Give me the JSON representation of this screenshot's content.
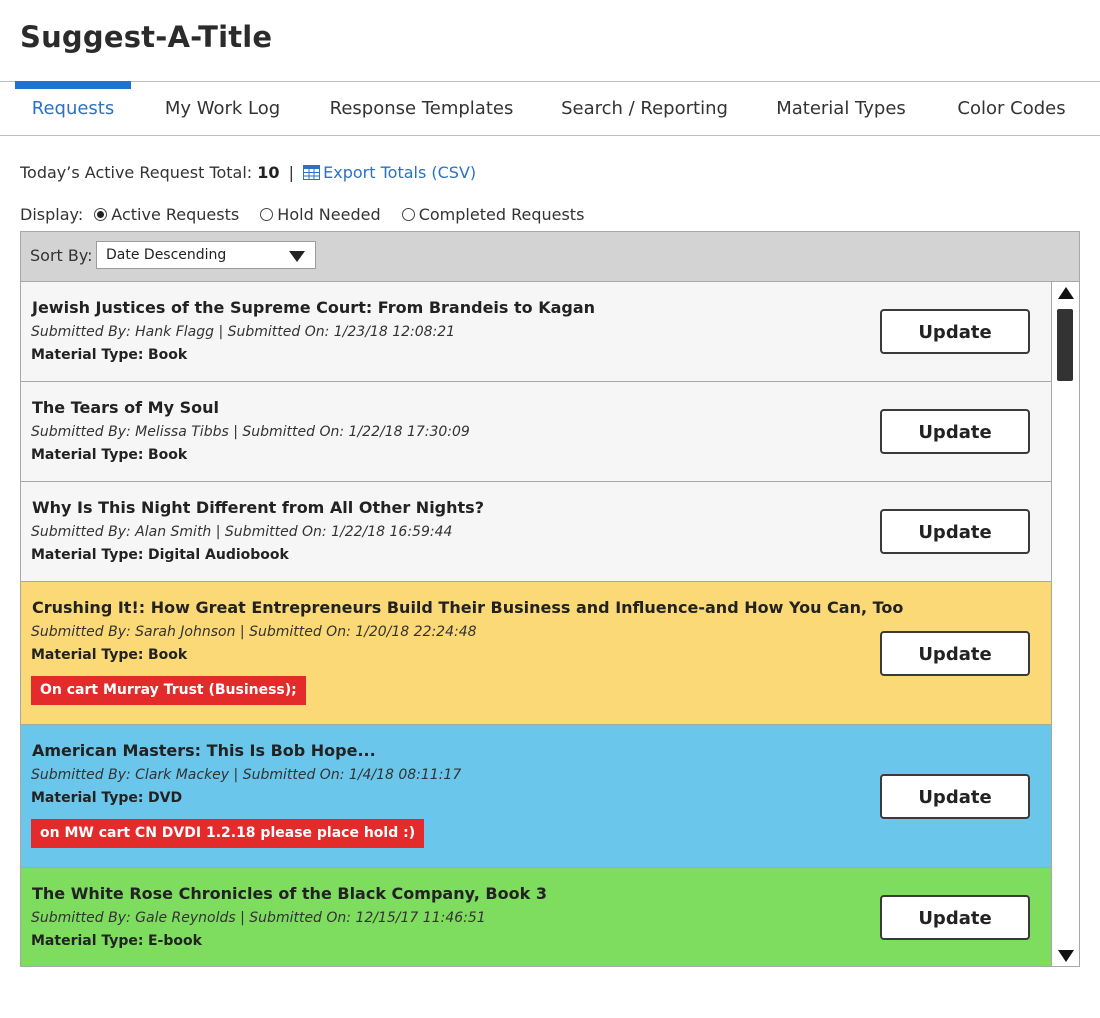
{
  "app": {
    "title": "Suggest-A-Title"
  },
  "tabs": [
    {
      "label": "Requests",
      "active": true
    },
    {
      "label": "My Work Log",
      "active": false
    },
    {
      "label": "Response Templates",
      "active": false
    },
    {
      "label": "Search / Reporting",
      "active": false
    },
    {
      "label": "Material Types",
      "active": false
    },
    {
      "label": "Color Codes",
      "active": false
    }
  ],
  "totals": {
    "label": "Today’s Active Request Total:",
    "count": "10",
    "separator": "|",
    "export_label": "Export Totals (CSV)",
    "export_icon": "spreadsheet-grid-icon"
  },
  "display": {
    "label": "Display:",
    "options": [
      {
        "label": "Active Requests",
        "checked": true
      },
      {
        "label": "Hold Needed",
        "checked": false
      },
      {
        "label": "Completed Requests",
        "checked": false
      }
    ]
  },
  "sort": {
    "label": "Sort By:",
    "selected": "Date Descending"
  },
  "requests": [
    {
      "title": "Jewish Justices of the Supreme Court: From Brandeis to Kagan",
      "submitted": "Submitted By: Hank Flagg | Submitted On: 1/23/18 12:08:21",
      "material_label": "Material Type:",
      "material": "Book",
      "note": "",
      "color": "#f6f6f6",
      "update_label": "Update"
    },
    {
      "title": "The Tears of My Soul",
      "submitted": "Submitted By: Melissa Tibbs | Submitted On: 1/22/18 17:30:09",
      "material_label": "Material Type:",
      "material": "Book",
      "note": "",
      "color": "#f6f6f6",
      "update_label": "Update"
    },
    {
      "title": "Why Is This Night Different from All Other Nights?",
      "submitted": "Submitted By: Alan Smith | Submitted On: 1/22/18 16:59:44",
      "material_label": "Material Type:",
      "material": "Digital Audiobook",
      "note": "",
      "color": "#f6f6f6",
      "update_label": "Update"
    },
    {
      "title": "Crushing It!: How Great Entrepreneurs Build Their Business and Influence-and How You Can, Too",
      "submitted": "Submitted By: Sarah Johnson | Submitted On: 1/20/18 22:24:48",
      "material_label": "Material Type:",
      "material": "Book",
      "note": "On cart Murray Trust (Business);",
      "color": "#fbd976",
      "update_label": "Update"
    },
    {
      "title": "American Masters: This Is Bob Hope...",
      "submitted": "Submitted By: Clark Mackey | Submitted On: 1/4/18 08:11:17",
      "material_label": "Material Type:",
      "material": "DVD",
      "note": "on MW cart CN DVDI 1.2.18 please place hold :)",
      "color": "#6ac6ea",
      "update_label": "Update"
    },
    {
      "title": "The White Rose Chronicles of the Black Company, Book 3",
      "submitted": "Submitted By: Gale Reynolds | Submitted On: 12/15/17 11:46:51",
      "material_label": "Material Type:",
      "material": "E-book",
      "note": "",
      "color": "#7edc5f",
      "update_label": "Update"
    }
  ],
  "colors": {
    "accent": "#1f73cf",
    "link": "#2a72c4",
    "note_badge": "#e32b2b",
    "sort_bar": "#d3d3d3"
  }
}
